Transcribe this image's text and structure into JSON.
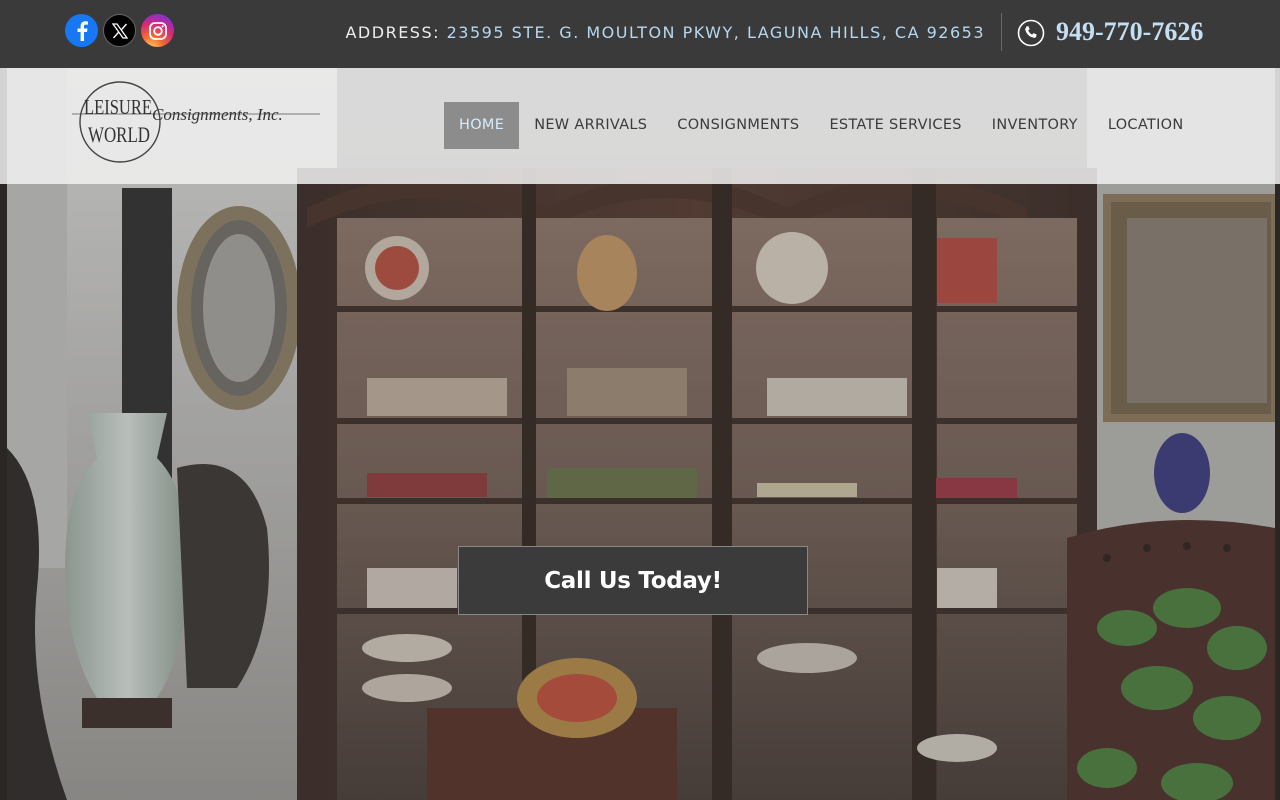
{
  "topbar": {
    "social": [
      "facebook-icon",
      "x-icon",
      "instagram-icon"
    ],
    "address_label": "ADDRESS:",
    "address_value": "23595 STE. G. MOULTON PKWY, LAGUNA HILLS, CA 92653",
    "phone": "949-770-7626"
  },
  "logo": {
    "word1": "LEISURE",
    "word2": "WORLD",
    "tagline": "Consignments, Inc."
  },
  "nav": {
    "items": [
      "HOME",
      "NEW ARRIVALS",
      "CONSIGNMENTS",
      "ESTATE SERVICES",
      "INVENTORY",
      "LOCATION"
    ],
    "active": "HOME"
  },
  "hero": {
    "cta_label": "Call Us Today!"
  },
  "colors": {
    "topbar_bg": "#3a3a3a",
    "accent_text": "#b6d7ee",
    "nav_active_bg": "#8c8c8c",
    "cta_bg": "#3b3b3b"
  }
}
